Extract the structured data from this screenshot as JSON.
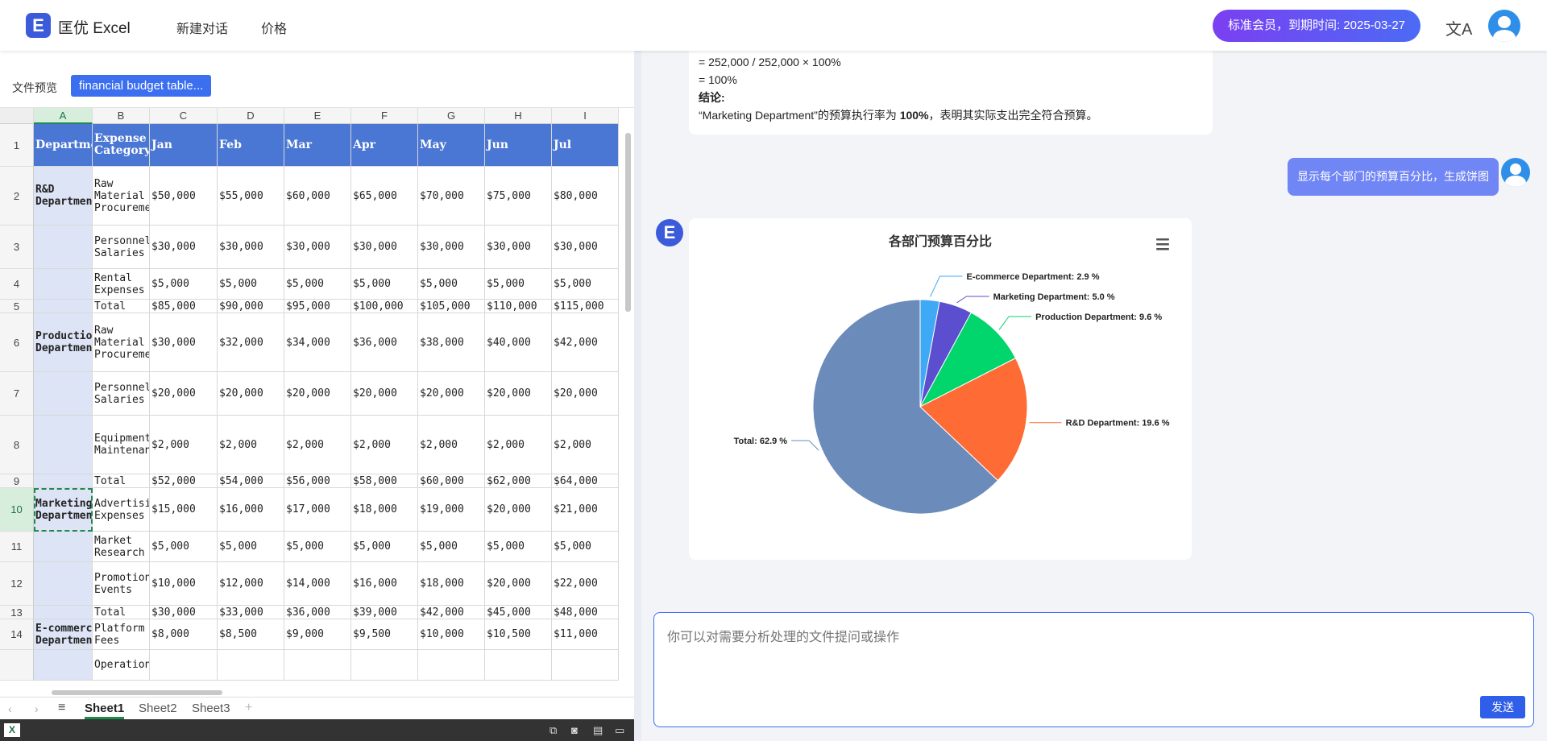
{
  "header": {
    "logo_letter": "E",
    "brand": "匡优 Excel",
    "nav": [
      "新建对话",
      "价格"
    ],
    "membership": "标准会员，到期时间: 2025-03-27",
    "translate_icon": "文A"
  },
  "file_panel": {
    "label": "文件预览",
    "file_name": "financial budget table...",
    "columns": [
      "A",
      "B",
      "C",
      "D",
      "E",
      "F",
      "G",
      "H",
      "I"
    ],
    "rows": [
      {
        "num": "1",
        "cells": [
          "Department",
          "Expense Category",
          "Jan",
          "Feb",
          "Mar",
          "Apr",
          "May",
          "Jun",
          "Jul"
        ]
      },
      {
        "num": "2",
        "cells": [
          "R&D Department",
          "Raw Material Procurement",
          "$50,000",
          "$55,000",
          "$60,000",
          "$65,000",
          "$70,000",
          "$75,000",
          "$80,000"
        ]
      },
      {
        "num": "3",
        "cells": [
          "",
          "Personnel Salaries",
          "$30,000",
          "$30,000",
          "$30,000",
          "$30,000",
          "$30,000",
          "$30,000",
          "$30,000"
        ]
      },
      {
        "num": "4",
        "cells": [
          "",
          "Rental Expenses",
          "$5,000",
          "$5,000",
          "$5,000",
          "$5,000",
          "$5,000",
          "$5,000",
          "$5,000"
        ]
      },
      {
        "num": "5",
        "cells": [
          "",
          "Total",
          "$85,000",
          "$90,000",
          "$95,000",
          "$100,000",
          "$105,000",
          "$110,000",
          "$115,000"
        ]
      },
      {
        "num": "6",
        "cells": [
          "Production Department",
          "Raw Material Procurement",
          "$30,000",
          "$32,000",
          "$34,000",
          "$36,000",
          "$38,000",
          "$40,000",
          "$42,000"
        ]
      },
      {
        "num": "7",
        "cells": [
          "",
          "Personnel Salaries",
          "$20,000",
          "$20,000",
          "$20,000",
          "$20,000",
          "$20,000",
          "$20,000",
          "$20,000"
        ]
      },
      {
        "num": "8",
        "cells": [
          "",
          "Equipment Maintenance",
          "$2,000",
          "$2,000",
          "$2,000",
          "$2,000",
          "$2,000",
          "$2,000",
          "$2,000"
        ]
      },
      {
        "num": "9",
        "cells": [
          "",
          "Total",
          "$52,000",
          "$54,000",
          "$56,000",
          "$58,000",
          "$60,000",
          "$62,000",
          "$64,000"
        ]
      },
      {
        "num": "10",
        "cells": [
          "Marketing Department",
          "Advertising Expenses",
          "$15,000",
          "$16,000",
          "$17,000",
          "$18,000",
          "$19,000",
          "$20,000",
          "$21,000"
        ]
      },
      {
        "num": "11",
        "cells": [
          "",
          "Market Research",
          "$5,000",
          "$5,000",
          "$5,000",
          "$5,000",
          "$5,000",
          "$5,000",
          "$5,000"
        ]
      },
      {
        "num": "12",
        "cells": [
          "",
          "Promotional Events",
          "$10,000",
          "$12,000",
          "$14,000",
          "$16,000",
          "$18,000",
          "$20,000",
          "$22,000"
        ]
      },
      {
        "num": "13",
        "cells": [
          "",
          "Total",
          "$30,000",
          "$33,000",
          "$36,000",
          "$39,000",
          "$42,000",
          "$45,000",
          "$48,000"
        ]
      },
      {
        "num": "14",
        "cells": [
          "E-commerce Department",
          "Platform Fees",
          "$8,000",
          "$8,500",
          "$9,000",
          "$9,500",
          "$10,000",
          "$10,500",
          "$11,000"
        ]
      },
      {
        "num": "",
        "cells": [
          "",
          "Operational",
          "",
          "",
          "",
          "",
          "",
          "",
          ""
        ]
      }
    ],
    "sheet_tabs": [
      "Sheet1",
      "Sheet2",
      "Sheet3"
    ],
    "active_tab": "Sheet1"
  },
  "chat": {
    "prev_answer": {
      "formula_line1": "= 252,000 / 252,000 × 100%",
      "formula_line2": "= 100%",
      "conclusion_label": "结论:",
      "conclusion_pre": "“Marketing Department”的预算执行率为 ",
      "conclusion_value": "100%",
      "conclusion_post": "，表明其实际支出完全符合预算。"
    },
    "user_message": "显示每个部门的预算百分比，生成饼图",
    "input_placeholder": "你可以对需要分析处理的文件提问或操作",
    "send_label": "发送"
  },
  "chart_data": {
    "type": "pie",
    "title": "各部门预算百分比",
    "slices": [
      {
        "label": "E-commerce Department",
        "value": 2.9,
        "color": "#3fa9f5"
      },
      {
        "label": "Marketing Department",
        "value": 5.0,
        "color": "#5b4fcf"
      },
      {
        "label": "Production Department",
        "value": 9.6,
        "color": "#00d66c"
      },
      {
        "label": "R&D Department",
        "value": 19.6,
        "color": "#ff6b35"
      },
      {
        "label": "Total",
        "value": 62.9,
        "color": "#6b8bba"
      }
    ],
    "unit": "%"
  }
}
